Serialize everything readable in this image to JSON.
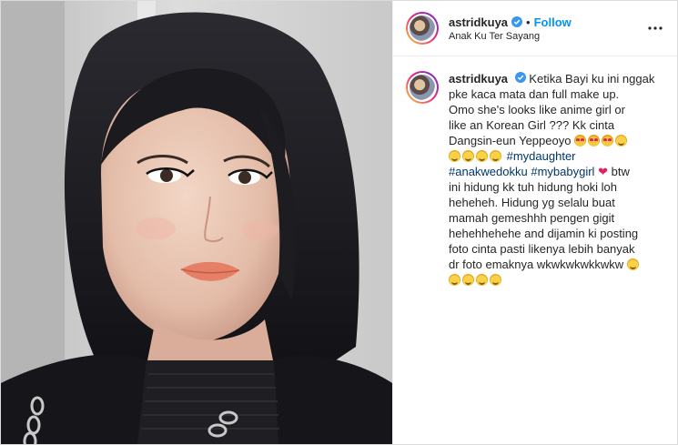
{
  "post": {
    "username": "astridkuya",
    "separator": "•",
    "follow_label": "Follow",
    "location": "Anak Ku Ter Sayang",
    "verified_icon": "verified-badge-icon",
    "more_icon": "more-options-icon",
    "caption": {
      "username": "astridkuya",
      "line1": "Ketika Bayi ku ini nggak",
      "line2": "pke kaca mata dan full make up.",
      "line3": "Omo she's looks like anime girl or",
      "line4": "like an Korean Girl ??? Kk cinta",
      "line5": "Dangsin-eun Yeppeoyo",
      "hashtag1": "#mydaughter",
      "hashtag2": "#anakwedokku",
      "hashtag3": "#mybabygirl",
      "line7_after": "btw",
      "line8": "ini hidung kk tuh hidung hoki loh",
      "line9": "heheheh. Hidung yg selalu buat",
      "line10": "mamah gemeshhh pengen gigit",
      "line11": "hehehhehehe and dijamin ki posting",
      "line12": "foto cinta pasti likenya lebih banyak",
      "line13": "dr foto emaknya wkwkwkwkkwkw",
      "heart_glyph": "❤"
    }
  },
  "colors": {
    "link": "#0095f6",
    "hashtag": "#00376b",
    "verified": "#3897f0",
    "heart": "#e0245e"
  }
}
